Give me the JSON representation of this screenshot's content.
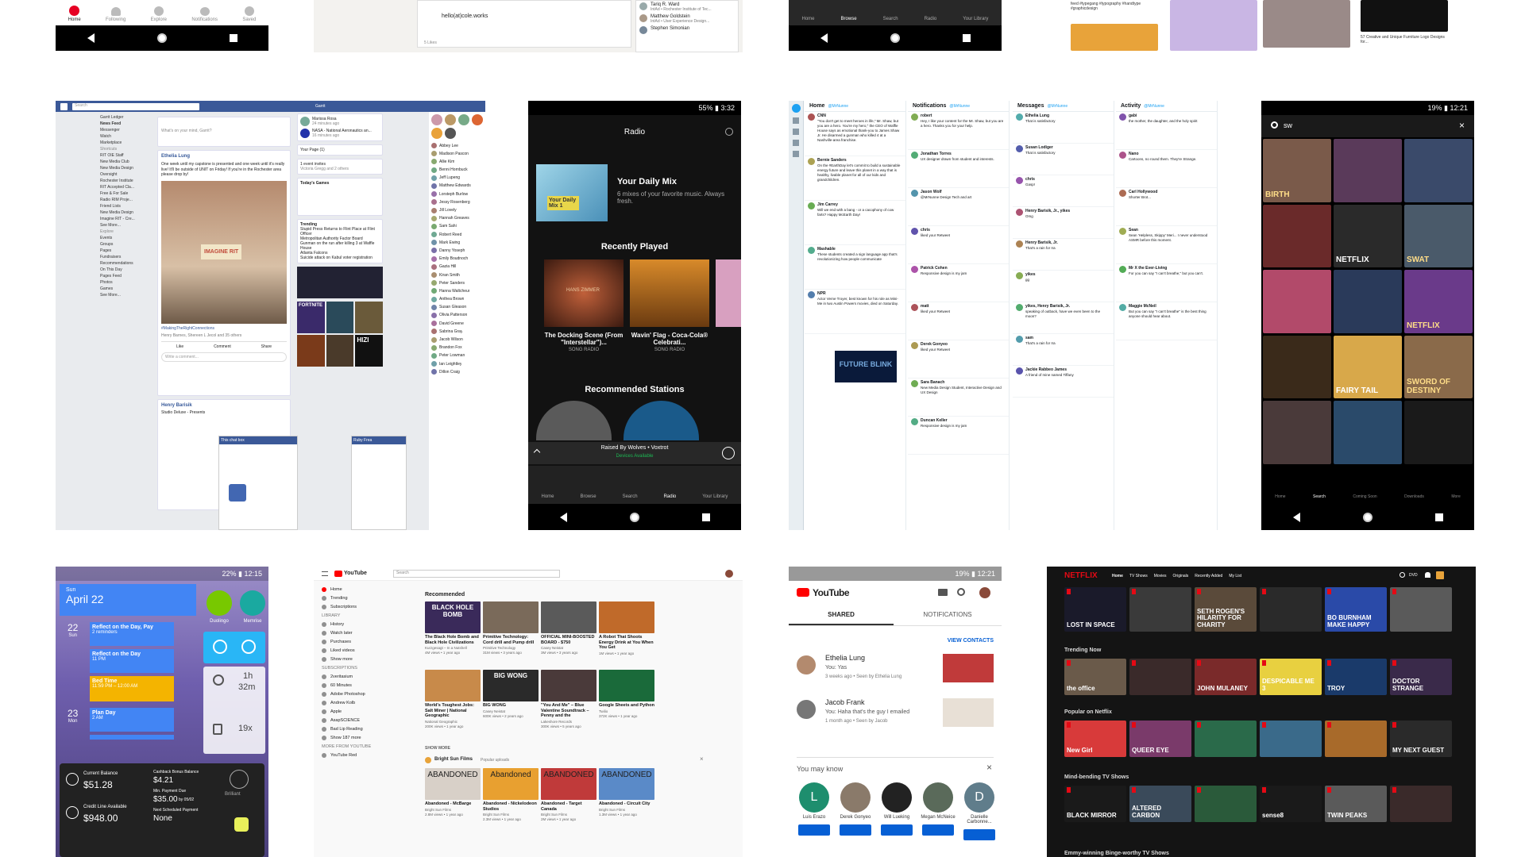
{
  "pinterest": {
    "tabs": [
      "Home",
      "Following",
      "Explore",
      "Notifications",
      "Saved"
    ]
  },
  "linkedin": {
    "email": "hello(at)cole.works",
    "likes": "5 Likes",
    "people": [
      {
        "name": "Tariq R. Ward",
        "sub": "IntAd • Rochester Institute of Tec..."
      },
      {
        "name": "Matthew Goldstein",
        "sub": "IntAd • User Experience Design..."
      },
      {
        "name": "Stephen Simonian",
        "sub": ""
      }
    ]
  },
  "spotify_top": {
    "tabs": [
      "Home",
      "Browse",
      "Search",
      "Radio",
      "Your Library"
    ]
  },
  "dribbble": {
    "caption1": "feed #typegang #typography #handtype #graphicdesign",
    "caption2": "57 Creative and Unique Furniture Logo Designs for..."
  },
  "facebook": {
    "search_placeholder": "Search",
    "user": "Garrit",
    "composer": "What's on your mind, Garrit?",
    "sidebar": [
      "Garrit Ledger",
      "News Feed",
      "Messenger",
      "Watch",
      "Marketplace",
      "Shortcuts",
      "RIT OIE Staff",
      "New Media Club",
      "New Media Design",
      "Oversight",
      "Rochester Institute",
      "RIT Accepted Cla...",
      "Free & For Sale",
      "Radio RIM Proje...",
      "Friend Lists",
      "New Media Design",
      "Imagine RIT - Cre...",
      "See More...",
      "Explore",
      "Events",
      "Groups",
      "Pages",
      "Fundraisers",
      "Recommendations",
      "On This Day",
      "Pages Feed",
      "Photos",
      "Games",
      "See More..."
    ],
    "post1_author": "Ethelia Lung",
    "post1_text": "One week until my capstone is presented and one week until it's really live! It'll be outside of UNIT on Friday! If you're in the Rochester area please drop by!",
    "post1_sign": "IMAGINE RIT",
    "post1_caption": "#MakingTheRightConnections",
    "post1_reactions": "Henry Barnes, Shereen L Jecol and 35 others",
    "like": "Like",
    "comment": "Comment",
    "share": "Share",
    "comment_placeholder": "Write a comment...",
    "post2_author": "Henry Barisik",
    "post2_sub": "Studio Deluxe - Presents",
    "right_stories": [
      {
        "name": "Marissa Rosa",
        "sub": "24 minutes ago"
      },
      {
        "name": "NASA - National Aeronautics an...",
        "sub": "16 minutes ago"
      }
    ],
    "your_pages": "Your Page (1)",
    "events": [
      "1 event invites",
      "Victoria Gregg and 2 others"
    ],
    "todays_games": "Today's Games",
    "trending_title": "Trending",
    "trending": [
      "Stupid Press Returns to Flint Place at Flint Officer",
      "Metropolitan Authority Factor Board",
      "Gunman on the run after killing 3 at Waffle House",
      "Atlanta Falcons",
      "Suicide attack on Kabul voter registration"
    ],
    "fortnite": "FORTNITE",
    "hizi": "HIZI",
    "contacts": [
      "Abbey Lee",
      "Madison Pascon",
      "Allie Kim",
      "Benni Hornbuck",
      "Jeff Lupeng",
      "Matthew Edwards",
      "Lorsteph Burlow",
      "Jessy Rosenberg",
      "Jill Lovely",
      "Hannah Greaves",
      "Sam Sahi",
      "Robert Reed",
      "Mark Ewing",
      "Danny Yoseph",
      "Emily Boudnoch",
      "Gazia Hill",
      "Kiran Smith",
      "Peter Sanders",
      "Hanna Waltcheur",
      "Anthea Brown",
      "Susan Gleason",
      "Olivia Patterson",
      "David Greene",
      "Sabrina Gray",
      "Jacob Wilson",
      "Brandon Fox",
      "Peter Lowman",
      "Ian Leightley",
      "Dillon Craig"
    ],
    "chats": [
      {
        "name": "This chat box"
      },
      {
        "name": "Ruby Frea"
      }
    ]
  },
  "spotify": {
    "status": "55% ▮ 3:32",
    "title": "Radio",
    "daily_title": "Your Daily Mix",
    "daily_sub": "6 mixes of your favorite music. Always fresh.",
    "daily_cover": "Your Daily Mix 1",
    "recent_title": "Recently Played",
    "recent": [
      {
        "title": "The Docking Scene (From \"Interstellar\")...",
        "sub": "SONG RADIO",
        "cover": "HANS ZIMMER"
      },
      {
        "title": "Wavin' Flag - Coca-Cola® Celebrati...",
        "sub": "SONG RADIO",
        "cover": ""
      }
    ],
    "stations_title": "Recommended Stations",
    "now_playing": "Raised By Wolves • Voxtrot",
    "devices": "Devices Available",
    "tabs": [
      "Home",
      "Browse",
      "Search",
      "Radio",
      "Your Library"
    ]
  },
  "tweetdeck": {
    "cols": [
      {
        "title": "Home",
        "handle": "@MrNunne",
        "items": [
          {
            "who": "CNN",
            "txt": "\"You don't get to meet heroes in life,\" Mr. Shaw, but you are a hero. You're my hero,\" the CEO of Waffle House says as emotional thank-you to James Shaw Jr. He disarmed a gunman who killed 4 at a Nashville-area franchise."
          },
          {
            "who": "Bernie Sanders",
            "txt": "On the #EarthDay let's commit to build a sustainable energy future and leave this planet in a way that is healthy, livable planet for all of our kids and grandchildren."
          },
          {
            "who": "Jim Carrey",
            "txt": "Will we end with a bang - or a cacophony of cow farts? Happy McEarth Day!"
          },
          {
            "who": "Mashable",
            "txt": "These students created a sign language app that's revolutionizing how people communicate"
          },
          {
            "who": "NPR",
            "txt": "Actor Verne Troyer, best known for his role as Mini-Me in two Austin Powers movies, died on Saturday."
          }
        ],
        "banner": "FUTURE BLINK"
      },
      {
        "title": "Notifications",
        "handle": "@MrNunne",
        "items": [
          {
            "who": "robert",
            "txt": "Hey, I like your content for the Mr. Shaw, but you are a hero. Thanks you for your help."
          },
          {
            "who": "Jonathan Torres",
            "txt": "UX designer drawn from student and interests."
          },
          {
            "who": "Jason Wolf",
            "txt": "@MrNunne Design Tech and art"
          },
          {
            "who": "chris",
            "txt": "liked your Retweet"
          },
          {
            "who": "Patrick Cohen",
            "txt": "Responsive design is my jam"
          },
          {
            "who": "matt",
            "txt": "liked your Retweet"
          },
          {
            "who": "Derek Gonyeo",
            "txt": "liked your Retweet"
          },
          {
            "who": "Sara Banach",
            "txt": "New Media Design Student, Interactive Design and UX Design"
          },
          {
            "who": "Duncan Keller",
            "txt": "Responsive design is my jam"
          }
        ]
      },
      {
        "title": "Messages",
        "handle": "@MrNunne",
        "items": [
          {
            "who": "Ethelia Lung",
            "txt": "That is satisfactory"
          },
          {
            "who": "Susan Lodiger",
            "txt": "That is satisfactory"
          },
          {
            "who": "chris",
            "txt": "Gasp!"
          },
          {
            "who": "Henry Barisik, Jr., yikes",
            "txt": "Omg"
          },
          {
            "who": "Henry Barisik, Jr.",
            "txt": "That's a rain for Ira"
          },
          {
            "who": "yikes",
            "txt": "gg"
          },
          {
            "who": "yikes, Henry Barisik, Jr.",
            "txt": "speaking of outback, have we even been to the moon?"
          },
          {
            "who": "sam",
            "txt": "That's a rain for Ira"
          },
          {
            "who": "Jackie Rabbeo James",
            "txt": "A friend of mine named Tiffany"
          }
        ]
      },
      {
        "title": "Activity",
        "handle": "@MrNunne",
        "items": [
          {
            "who": "gabi",
            "txt": "the mother, the daughter, and the holy spirit"
          },
          {
            "who": "Nano",
            "txt": "Cartoons, no round them. They're Strange."
          },
          {
            "who": "Carl Hollywood",
            "txt": "Shorter Brot..."
          },
          {
            "who": "Sean",
            "txt": "Sean 'Helpless, Skippy' Meri... I never understood ASMR before this moment."
          },
          {
            "who": "Mr X the Ever-Living",
            "txt": "For you can say \"I can't breathe,\" but you can't."
          },
          {
            "who": "Maggie McNeil",
            "txt": "But you can say \"I can't breathe\" is the best thing anyone should hear about."
          }
        ]
      }
    ]
  },
  "netflix_search": {
    "status": "19% ▮ 12:21",
    "query": "sw",
    "posters": [
      "BIRTH",
      "",
      "",
      "",
      "NETFLIX",
      "SWAT",
      "",
      "",
      "NETFLIX",
      "",
      "FAIRY TAIL",
      "SWORD OF DESTINY",
      "",
      "",
      ""
    ],
    "tabs": [
      "Home",
      "Search",
      "Coming Soon",
      "Downloads",
      "More"
    ]
  },
  "calendar": {
    "status": "22% ▮ 12:15",
    "day_name": "Sun",
    "month_title": "April 22",
    "day1_num": "22",
    "day1_name": "Sun",
    "day2_num": "23",
    "day2_name": "Mon",
    "events": [
      {
        "title": "Reflect on the Day, Pay",
        "sub": "2 reminders"
      },
      {
        "title": "Reflect on the Day",
        "sub": "11 PM"
      },
      {
        "title": "Bed Time",
        "sub": "11:59 PM – 12:00 AM"
      },
      {
        "title": "Plan Day",
        "sub": "2 AM"
      }
    ],
    "apps": [
      "Duolingo",
      "Memrise"
    ],
    "timer1": "1h",
    "timer2": "32m",
    "count": "19x",
    "card": {
      "current_label": "Current Balance",
      "current": "$51.28",
      "credit_label": "Credit Line Available",
      "credit": "$948.00",
      "bonus_label": "Cashback Bonus Balance",
      "bonus": "$4.21",
      "min_label": "Min. Payment Due",
      "min": "$35.00",
      "min_date": "by 05/02",
      "next_label": "Next Scheduled Payment",
      "next": "None"
    },
    "brand": "Brilliant"
  },
  "youtube_web": {
    "logo": "YouTube",
    "search_placeholder": "Search",
    "side": [
      "Home",
      "Trending",
      "Subscriptions",
      "LIBRARY",
      "History",
      "Watch later",
      "Purchases",
      "Liked videos",
      "Show more",
      "SUBSCRIPTIONS",
      "2veritasium",
      "60 Minutes",
      "Adobe Photoshop",
      "Andrew Kolb",
      "Apple",
      "AsapSCIENCE",
      "Bad Lip Reading",
      "Show 187 more",
      "MORE FROM YOUTUBE",
      "YouTube Red"
    ],
    "rec_title": "Recommended",
    "videos": [
      {
        "title": "The Black Hole Bomb and Black Hole Civilizations",
        "ch": "Kurzgesagt – In a Nutshell",
        "st": "4M views • 1 year ago",
        "thumb": "BLACK HOLE BOMB"
      },
      {
        "title": "Primitive Technology: Cord drill and Pump drill",
        "ch": "Primitive Technology",
        "st": "31M views • 3 years ago",
        "thumb": ""
      },
      {
        "title": "OFFICIAL MINI-BOOSTED BOARD - $750",
        "ch": "Casey Neistat",
        "st": "3M views • 3 years ago",
        "thumb": ""
      },
      {
        "title": "A Robot That Shoots Energy Drink at You When You Get",
        "ch": "",
        "st": "1M views • 1 year ago",
        "thumb": ""
      },
      {
        "title": "World's Toughest Jobs: Salt Miner | National Geographic",
        "ch": "National Geographic",
        "st": "200K views • 1 year ago",
        "thumb": ""
      },
      {
        "title": "BIG WONG",
        "ch": "Casey Neistat",
        "st": "600K views • 2 years ago",
        "thumb": "BIG WONG"
      },
      {
        "title": "\"You And Me\" – Blue Valentine Soundtrack – Penny and the",
        "ch": "Lakeshore Records",
        "st": "300K views • 5 years ago",
        "thumb": ""
      },
      {
        "title": "Google Sheets and Python",
        "ch": "Twilio",
        "st": "372K views • 1 year ago",
        "thumb": ""
      }
    ],
    "show_more": "SHOW MORE",
    "channel": "Bright Sun Films",
    "channel_sub": "Popular uploads",
    "abandoned": [
      {
        "title": "Abandoned - McBarge",
        "st": "2.8M views • 1 year ago",
        "thumb": "ABANDONED"
      },
      {
        "title": "Abandoned - Nickelodeon Studios",
        "st": "2.3M views • 1 year ago",
        "thumb": "Abandoned"
      },
      {
        "title": "Abandoned - Target Canada",
        "st": "2M views • 1 year ago",
        "thumb": "ABANDONED"
      },
      {
        "title": "Abandoned - Circuit City",
        "st": "1.3M views • 1 year ago",
        "thumb": "ABANDONED"
      }
    ]
  },
  "youtube_mobile": {
    "status": "19% ▮ 12:21",
    "logo": "YouTube",
    "tabs": [
      "SHARED",
      "NOTIFICATIONS"
    ],
    "view_contacts": "VIEW CONTACTS",
    "shares": [
      {
        "name": "Ethelia Lung",
        "msg": "You: Yas",
        "meta": "3 weeks ago • Seen by Ethelia Lung"
      },
      {
        "name": "Jacob Frank",
        "msg": "You: Haha that's the guy I emailed",
        "meta": "1 month ago • Seen by Jacob"
      }
    ],
    "may_know": "You may know",
    "people": [
      {
        "initial": "L",
        "name": "Luis Erazo",
        "color": "#1e8e6e"
      },
      {
        "initial": "",
        "name": "Derek Gonyeo",
        "color": "#8a7a6a"
      },
      {
        "initial": "",
        "name": "Will Lueking",
        "color": "#222"
      },
      {
        "initial": "",
        "name": "Megan McNeice",
        "color": "#5a6a5a"
      },
      {
        "initial": "D",
        "name": "Danielle Carbonne...",
        "color": "#607d8b"
      }
    ]
  },
  "netflix_web": {
    "logo": "NETFLIX",
    "nav": [
      "Home",
      "TV Shows",
      "Movies",
      "Originals",
      "Recently Added",
      "My List"
    ],
    "profile": "DVD",
    "rows": [
      {
        "title": "",
        "posters": [
          "LOST IN SPACE",
          "",
          "SETH ROGEN'S HILARITY FOR CHARITY",
          "",
          "BO BURNHAM MAKE HAPPY",
          ""
        ]
      },
      {
        "title": "Trending Now",
        "posters": [
          "the office",
          "",
          "JOHN MULANEY",
          "DESPICABLE ME 3",
          "TROY",
          "DOCTOR STRANGE"
        ]
      },
      {
        "title": "Popular on Netflix",
        "posters": [
          "New Girl",
          "QUEER EYE",
          "",
          "",
          "",
          "MY NEXT GUEST"
        ]
      },
      {
        "title": "Mind-bending TV Shows",
        "posters": [
          "BLACK MIRROR",
          "ALTERED CARBON",
          "",
          "sense8",
          "TWIN PEAKS",
          ""
        ]
      }
    ],
    "footer_row": "Emmy-winning Binge-worthy TV Shows"
  },
  "colors": {
    "facebook": "#3b5998",
    "spotify_green": "#1db954",
    "twitter_blue": "#1da1f2",
    "netflix_red": "#e50914",
    "youtube_red": "#ff0000"
  }
}
